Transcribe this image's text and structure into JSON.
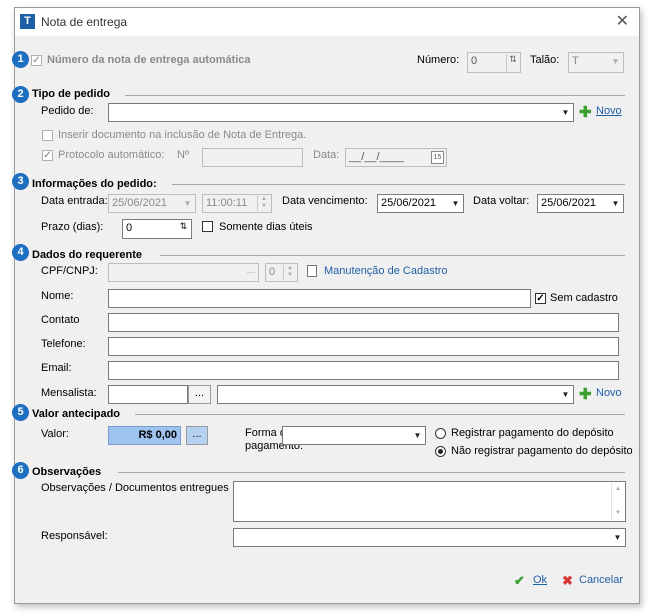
{
  "window": {
    "title": "Nota de entrega"
  },
  "badges": [
    "1",
    "2",
    "3",
    "4",
    "5",
    "6"
  ],
  "header": {
    "auto_number_label": "Número da nota de entrega automática",
    "numero_label": "Número:",
    "numero_value": "0",
    "talao_label": "Talão:",
    "talao_value": "T"
  },
  "tipo_pedido": {
    "title": "Tipo de pedido",
    "pedido_de_label": "Pedido de:",
    "pedido_de_value": "",
    "novo_label": "Novo",
    "inserir_doc_label": "Inserir documento na inclusão de Nota de Entrega.",
    "protocolo_label": "Protocolo automático:",
    "num_label": "Nº",
    "num_value": "",
    "data_label": "Data:",
    "data_value": "__/__/____",
    "calendar_text": "15"
  },
  "informacoes": {
    "title": "Informações do pedido:",
    "data_entrada_label": "Data entrada:",
    "data_entrada_value": "25/06/2021",
    "hora_value": "11:00:11",
    "data_vencimento_label": "Data vencimento:",
    "data_vencimento_value": "25/06/2021",
    "data_voltar_label": "Data voltar:",
    "data_voltar_value": "25/06/2021",
    "prazo_label": "Prazo (dias):",
    "prazo_value": "0",
    "somente_uteis_label": "Somente dias úteis"
  },
  "requerente": {
    "title": "Dados do requerente",
    "cpf_label": "CPF/CNPJ:",
    "cpf_value": "",
    "cpf_button": "...",
    "tipo_value": "0",
    "manutencao_label": "Manutenção de Cadastro",
    "nome_label": "Nome:",
    "nome_value": "",
    "sem_cadastro_label": "Sem cadastro",
    "contato_label": "Contato",
    "telefone_label": "Telefone:",
    "email_label": "Email:",
    "mensalista_label": "Mensalista:",
    "mensalista_button": "...",
    "novo_label": "Novo"
  },
  "valor": {
    "title": "Valor antecipado",
    "valor_label": "Valor:",
    "valor_value": "R$ 0,00",
    "valor_button": "...",
    "forma_label_1": "Forma de",
    "forma_label_2": "pagamento:",
    "registrar_label": "Registrar pagamento do depósito",
    "nao_registrar_label": "Não registrar pagamento do depósito"
  },
  "observacoes": {
    "title": "Observações",
    "obs_label": "Observações / Documentos entregues",
    "responsavel_label": "Responsável:"
  },
  "footer": {
    "ok_label": "Ok",
    "cancelar_label": "Cancelar"
  },
  "colors": {
    "accent": "#1f6fc0",
    "valor_bg": "#9ec3ef",
    "ok_green": "#3aa12e",
    "cancel_red": "#d83a3a"
  }
}
